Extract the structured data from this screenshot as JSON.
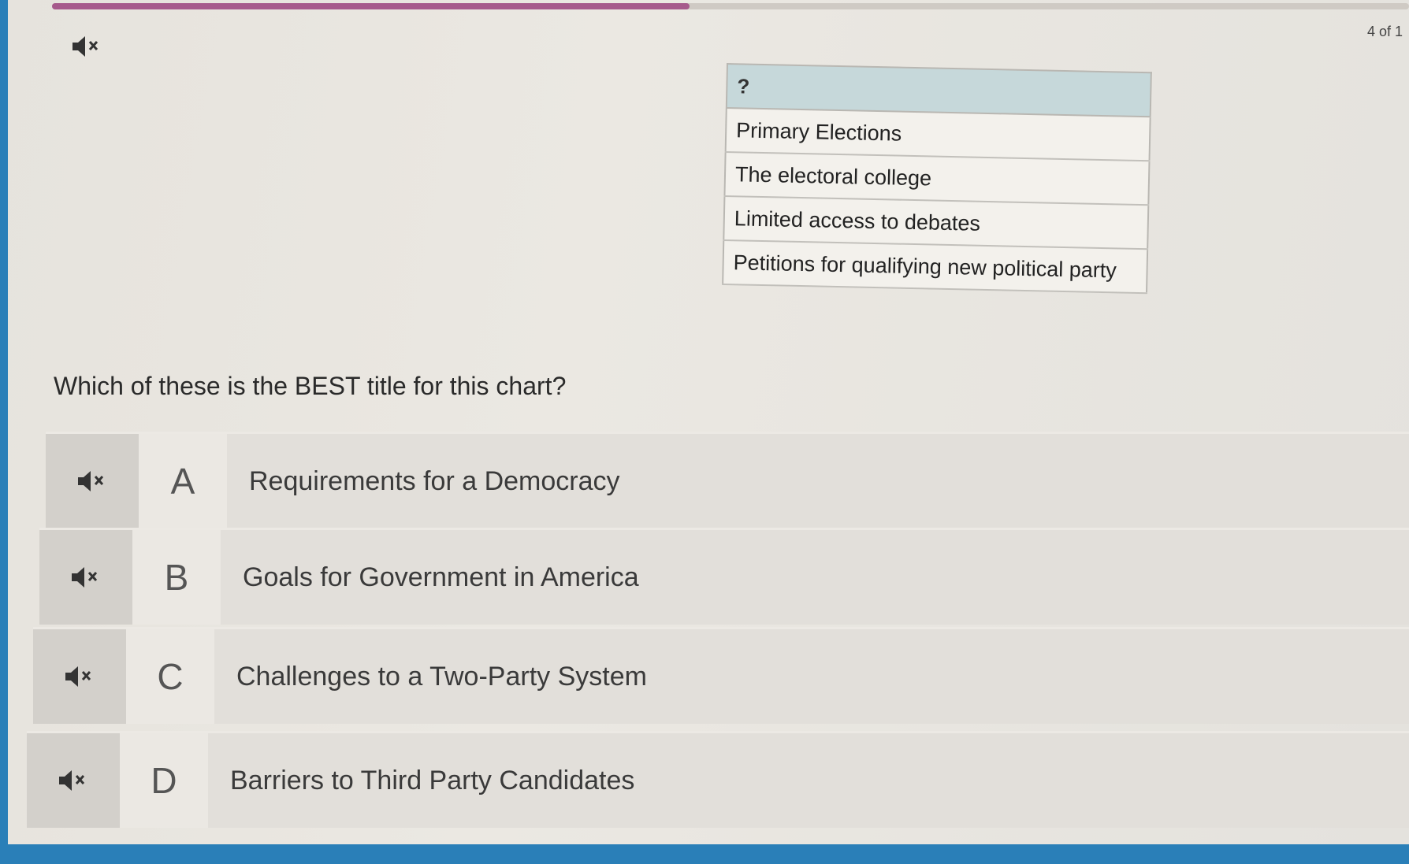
{
  "progress": {
    "label": "4 of 1",
    "fraction": 0.47
  },
  "audio": {
    "icon": "mute-speaker-icon"
  },
  "chart": {
    "header": "?",
    "rows": [
      "Primary Elections",
      "The electoral college",
      "Limited access to debates",
      "Petitions for qualifying new political party"
    ]
  },
  "question": "Which of these is the BEST title for this chart?",
  "options": [
    {
      "letter": "A",
      "text": "Requirements for a Democracy"
    },
    {
      "letter": "B",
      "text": "Goals for Government in America"
    },
    {
      "letter": "C",
      "text": "Challenges to a Two-Party System"
    },
    {
      "letter": "D",
      "text": "Barriers to Third Party Candidates"
    }
  ],
  "colors": {
    "progress": "#a65a8c",
    "table_header": "#c6d8da",
    "frame": "#2a7fb8"
  }
}
